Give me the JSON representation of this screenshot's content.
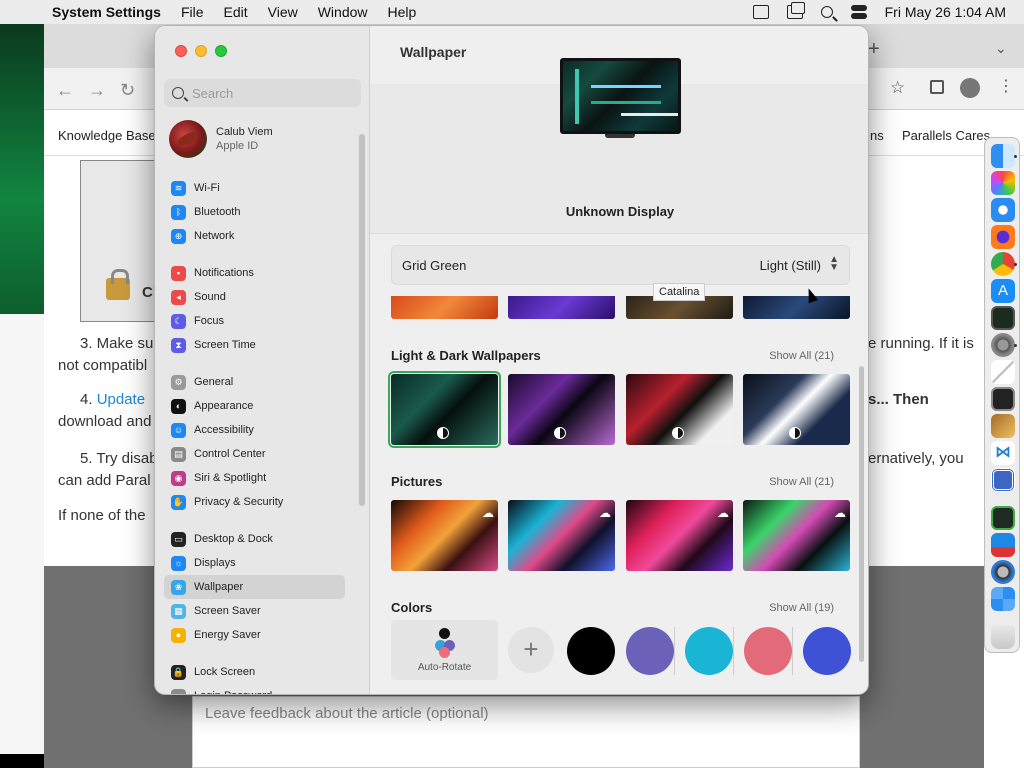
{
  "menubar": {
    "app_name": "System Settings",
    "items": [
      "File",
      "Edit",
      "View",
      "Window",
      "Help"
    ],
    "clock": "Fri May 26  1:04 AM"
  },
  "browser": {
    "bookmarks": {
      "left": "Knowledge Base",
      "right_partial": "ns",
      "right": "Parallels Cares"
    },
    "lines": {
      "l3a": "3. Make su",
      "l3b": "not compatibl",
      "l3c": "e running. If it is",
      "l4_prefix": "4. ",
      "l4_link": "Update",
      "l4b": "download and",
      "l4c": "s... Then",
      "l5a": "5. Try disab",
      "l5b": "can add Paral",
      "l5c": "ernatively, you",
      "l6": "If none of the",
      "ch": "Ch"
    },
    "feedback_placeholder": "Leave feedback about the article (optional)"
  },
  "sidebar": {
    "search_placeholder": "Search",
    "account": {
      "name": "Calub Viem",
      "sub": "Apple ID"
    },
    "items": [
      {
        "label": "Wi-Fi",
        "color": "#1e88f0",
        "glyph": "≋"
      },
      {
        "label": "Bluetooth",
        "color": "#1e88f0",
        "glyph": "ᛒ"
      },
      {
        "label": "Network",
        "color": "#1e88f0",
        "glyph": "⊕"
      },
      {
        "label": "Notifications",
        "color": "#ef4a4a",
        "glyph": "▪"
      },
      {
        "label": "Sound",
        "color": "#ef4a4a",
        "glyph": "◂"
      },
      {
        "label": "Focus",
        "color": "#5e5ce6",
        "glyph": "☾"
      },
      {
        "label": "Screen Time",
        "color": "#5e5ce6",
        "glyph": "⧗"
      },
      {
        "label": "General",
        "color": "#9a9a9a",
        "glyph": "⚙"
      },
      {
        "label": "Appearance",
        "color": "#111111",
        "glyph": "◐"
      },
      {
        "label": "Accessibility",
        "color": "#1e88f0",
        "glyph": "☺"
      },
      {
        "label": "Control Center",
        "color": "#8a8a8a",
        "glyph": "▤"
      },
      {
        "label": "Siri & Spotlight",
        "color": "#c03b8c",
        "glyph": "◉"
      },
      {
        "label": "Privacy & Security",
        "color": "#1e88f0",
        "glyph": "✋"
      },
      {
        "label": "Desktop & Dock",
        "color": "#222222",
        "glyph": "▭"
      },
      {
        "label": "Displays",
        "color": "#1e88f0",
        "glyph": "☼"
      },
      {
        "label": "Wallpaper",
        "color": "#37a6e8",
        "glyph": "❀"
      },
      {
        "label": "Screen Saver",
        "color": "#4fb4e6",
        "glyph": "▦"
      },
      {
        "label": "Energy Saver",
        "color": "#f5b301",
        "glyph": "●"
      },
      {
        "label": "Lock Screen",
        "color": "#222222",
        "glyph": "🔒"
      },
      {
        "label": "Login Password",
        "color": "#8a8a8a",
        "glyph": "•"
      }
    ],
    "active": "Wallpaper"
  },
  "content": {
    "title": "Wallpaper",
    "display_name": "Unknown Display",
    "wallpaper_name": "Grid Green",
    "mode": "Light (Still)",
    "tooltip": "Catalina",
    "sections": {
      "light_dark": {
        "title": "Light & Dark Wallpapers",
        "show_all": "Show All (21)"
      },
      "pictures": {
        "title": "Pictures",
        "show_all": "Show All (21)"
      },
      "colors": {
        "title": "Colors",
        "show_all": "Show All (19)"
      }
    },
    "auto_rotate_label": "Auto-Rotate",
    "color_swatches": [
      "#000000",
      "#6b61b8",
      "#1ab4d4",
      "#e36a78",
      "#3f52d6"
    ]
  }
}
